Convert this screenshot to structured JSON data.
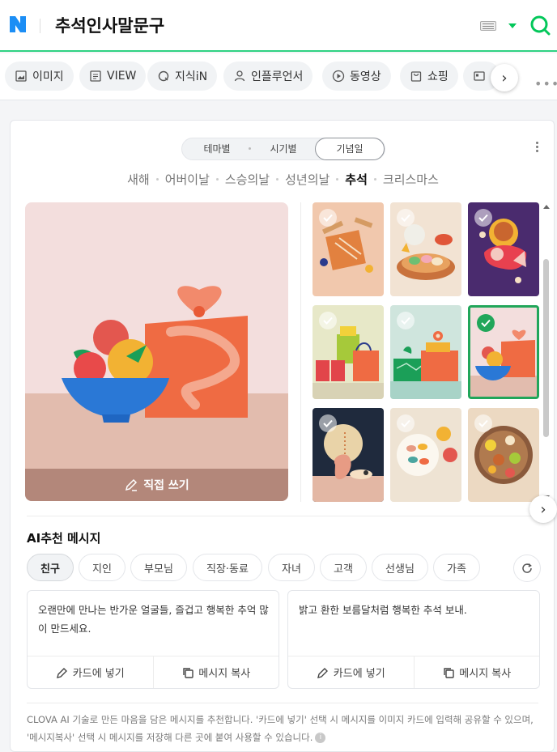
{
  "header": {
    "query": "추석인사말문구"
  },
  "tabs": [
    {
      "label": "이미지",
      "icon": "image-icon"
    },
    {
      "label": "VIEW",
      "icon": "document-icon"
    },
    {
      "label": "지식iN",
      "icon": "q-icon"
    },
    {
      "label": "인플루언서",
      "icon": "person-icon"
    },
    {
      "label": "동영상",
      "icon": "play-icon"
    },
    {
      "label": "쇼핑",
      "icon": "bag-icon"
    }
  ],
  "card": {
    "segments": [
      "테마별",
      "시기별",
      "기념일"
    ],
    "active_segment": "기념일",
    "occasions": [
      "새해",
      "어버이날",
      "스승의날",
      "성년의날",
      "추석",
      "크리스마스"
    ],
    "active_occasion": "추석",
    "write_label": "직접 쓰기"
  },
  "ai": {
    "title": "AI추천 메시지",
    "chips": [
      "친구",
      "지인",
      "부모님",
      "직장·동료",
      "자녀",
      "고객",
      "선생님",
      "가족"
    ],
    "active_chip": "친구",
    "messages": [
      {
        "text": "오랜만에 만나는 반가운 얼굴들, 즐겁고 행복한 추억 많이 만드세요.",
        "insert": "카드에 넣기",
        "copy": "메시지 복사"
      },
      {
        "text": "밝고 환한 보름달처럼 행복한 추석 보내.",
        "insert": "카드에 넣기",
        "copy": "메시지 복사"
      }
    ],
    "footnote": "CLOVA AI 기술로 만든 마음을 담은 메시지를 추천합니다. '카드에 넣기' 선택 시 메시지를 이미지 카드에 입력해 공유할 수 있으며, '메시지복사' 선택 시 메시지를 저장해 다른 곳에 붙여 사용할 수 있습니다."
  },
  "colors": {
    "brand_green": "#03c75a",
    "selected_border": "#21a65a"
  }
}
